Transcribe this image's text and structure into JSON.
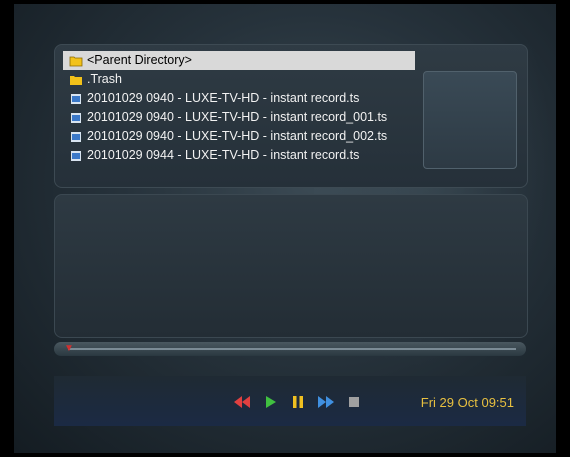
{
  "filelist": {
    "items": [
      {
        "label": "<Parent Directory>",
        "icon": "folder-open-icon",
        "selected": true
      },
      {
        "label": ".Trash",
        "icon": "folder-icon",
        "selected": false
      },
      {
        "label": "20101029 0940 - LUXE-TV-HD - instant record.ts",
        "icon": "video-file-icon",
        "selected": false
      },
      {
        "label": "20101029 0940 - LUXE-TV-HD - instant record_001.ts",
        "icon": "video-file-icon",
        "selected": false
      },
      {
        "label": "20101029 0940 - LUXE-TV-HD - instant record_002.ts",
        "icon": "video-file-icon",
        "selected": false
      },
      {
        "label": "20101029 0944 - LUXE-TV-HD - instant record.ts",
        "icon": "video-file-icon",
        "selected": false
      }
    ]
  },
  "controls": [
    "rewind-icon",
    "play-icon",
    "pause-icon",
    "fast-forward-icon",
    "stop-icon"
  ],
  "status": {
    "datetime": "Fri 29 Oct  09:51"
  },
  "colors": {
    "selection": "#d9d9d9",
    "clock": "#e8c040",
    "rewind": "#e04040",
    "play": "#40c040",
    "pause": "#f0c020",
    "forward": "#4090e0"
  }
}
